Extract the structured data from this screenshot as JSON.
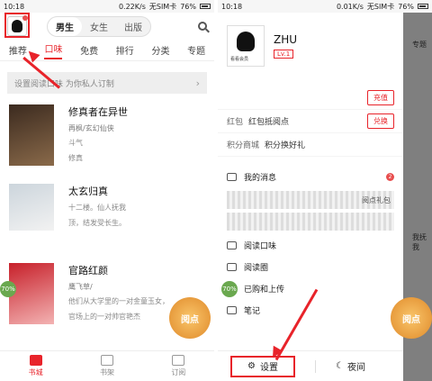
{
  "left": {
    "status": {
      "time": "10:18",
      "network": "0.22K/s",
      "carrier": "无SIM卡",
      "battery": "76%"
    },
    "gender_tabs": [
      "男生",
      "女生",
      "出版"
    ],
    "categories": [
      "推荐",
      "口味",
      "免费",
      "排行",
      "分类",
      "专题"
    ],
    "banner": "设置阅读口味 为你私人订制",
    "books": [
      {
        "title": "修真者在异世",
        "sub": "再枫/玄幻仙侠",
        "desc1": "斗气",
        "desc2": "修真"
      },
      {
        "title": "太玄归真",
        "sub": "",
        "desc1": "十二楼。仙人抚我",
        "desc2": "顶，结发受长生。"
      },
      {
        "title": "官路红颜",
        "sub": "鹰飞草/",
        "desc1": "他们从大学里的一对金童玉女，",
        "desc2": "官场上的一对帅官艳杰"
      }
    ],
    "badge": "70%",
    "promo": "阅点",
    "nav": [
      "书城",
      "书架",
      "订阅"
    ]
  },
  "right": {
    "status": {
      "time": "10:18",
      "network": "0.01K/s",
      "carrier": "无SIM卡",
      "battery": "76%"
    },
    "username": "ZHU",
    "level": "Lv.1",
    "avatar_caption": "看看会员",
    "recharge": "充值",
    "coupon_label": "红包",
    "coupon_text": "红包抵阅点",
    "exchange": "兑换",
    "mall_label": "积分商城",
    "mall_text": "积分换好礼",
    "menu": [
      {
        "label": "我的消息",
        "badge": "2"
      },
      {
        "label": "阅读口味",
        "badge": ""
      },
      {
        "label": "阅读圈",
        "badge": ""
      },
      {
        "label": "已购和上传",
        "badge": ""
      },
      {
        "label": "笔记",
        "badge": ""
      }
    ],
    "blurred_text": "阅点礼包",
    "settings": "设置",
    "night": "夜间",
    "dim_texts": [
      "专题",
      "我抚我"
    ],
    "badge": "70%",
    "promo": "阅点"
  },
  "colors": {
    "accent": "#e8232a",
    "badge_green": "#6aa84f"
  }
}
